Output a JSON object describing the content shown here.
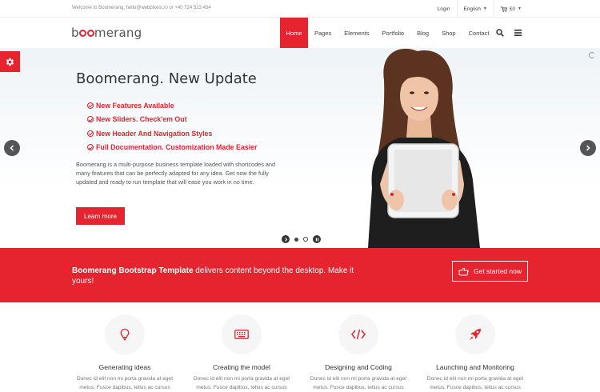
{
  "topbar": {
    "welcome": "Welcome to Boomerang, hello@webpixels.ro or +40 724 523 454",
    "login": "Login",
    "language": "English",
    "cart": "£0"
  },
  "header": {
    "logo_before": "b",
    "logo_after": "merang",
    "nav": [
      "Home",
      "Pages",
      "Elements",
      "Portfolio",
      "Blog",
      "Shop",
      "Contact"
    ]
  },
  "hero": {
    "title": "Boomerang. New Update",
    "features": [
      "New Features Available",
      "New Sliders. Check'em Out",
      "New Header And Navigation Styles",
      "Full Documentation. Customization Made Easier"
    ],
    "description": "Boomerang is a multi-purpose business template loaded with shortcodes and many features that can be perfectly adapted for any idea. Get now the fully updated and ready to run template that will ease you work in no time.",
    "button": "Learn more"
  },
  "cta": {
    "bold": "Boomerang Bootstrap Template",
    "text": " delivers content beyond the desktop. Make it yours!",
    "button": "Get started now"
  },
  "services": [
    {
      "icon": "lightbulb-icon",
      "title": "Generating ideas",
      "text": "Donec id elit non mi porta gravida at eget metus. Fusce dapibus, tellus ac cursus commodo, tortor mauris."
    },
    {
      "icon": "keyboard-icon",
      "title": "Creating the model",
      "text": "Donec id elit non mi porta gravida at eget metus. Fusce dapibus, tellus ac cursus commodo, tortor mauris."
    },
    {
      "icon": "code-icon",
      "title": "Designing and Coding",
      "text": "Donec id elit non mi porta gravida at eget metus. Fusce dapibus, tellus ac cursus commodo, tortor mauris."
    },
    {
      "icon": "rocket-icon",
      "title": "Launching and Monitoring",
      "text": "Donec id elit non mi porta gravida at eget metus. Fusce dapibus, tellus ac cursus commodo, tortor mauris."
    }
  ],
  "colors": {
    "accent": "#e62430",
    "text_dark": "#333333",
    "text_muted": "#777777"
  }
}
